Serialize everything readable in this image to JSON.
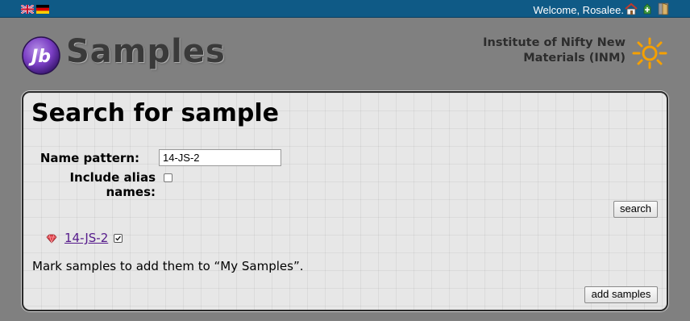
{
  "header": {
    "languages": [
      {
        "name": "english-flag-icon"
      },
      {
        "name": "german-flag-icon"
      }
    ],
    "welcome": "Welcome, Rosalee.",
    "icons": [
      "home-icon",
      "logout-icon",
      "door-icon"
    ]
  },
  "branding": {
    "logo_initials": "Jb",
    "app_name": "Samples",
    "institute_line1": "Institute of Nifty New",
    "institute_line2": "Materials (INM)",
    "accent_color": "#7b3fc4"
  },
  "search": {
    "title": "Search for sample",
    "name_label": "Name pattern:",
    "name_value": "14-JS-2",
    "alias_label": "Include alias names:",
    "alias_checked": false,
    "search_button": "search"
  },
  "results": {
    "items": [
      {
        "name": "14-JS-2",
        "icon": "ruby-icon",
        "checked": true
      }
    ],
    "hint": "Mark samples to add them to “My Samples”.",
    "add_button": "add samples"
  }
}
